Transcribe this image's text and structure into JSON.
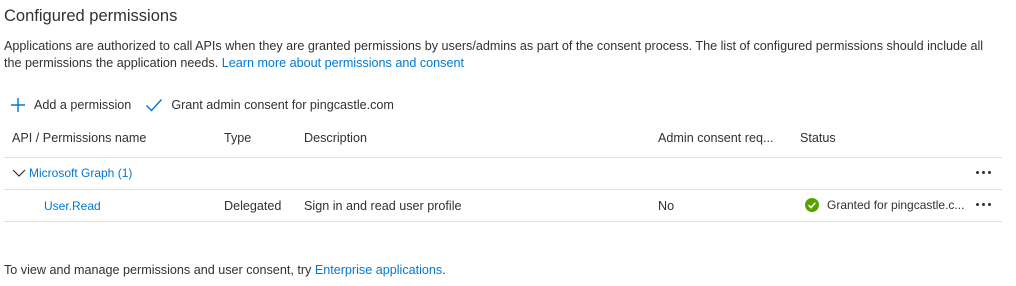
{
  "section_title": "Configured permissions",
  "description": {
    "text": "Applications are authorized to call APIs when they are granted permissions by users/admins as part of the consent process. The list of configured permissions should include all the permissions the application needs.",
    "link": "Learn more about permissions and consent"
  },
  "toolbar": {
    "add_label": "Add a permission",
    "grant_label": "Grant admin consent for pingcastle.com"
  },
  "table": {
    "headers": {
      "api": "API / Permissions name",
      "type": "Type",
      "description": "Description",
      "admin_consent": "Admin consent req...",
      "status": "Status"
    },
    "group": {
      "label": "Microsoft Graph (1)"
    },
    "rows": [
      {
        "name": "User.Read",
        "type": "Delegated",
        "description": "Sign in and read user profile",
        "admin_consent": "No",
        "status": "Granted for pingcastle.c..."
      }
    ]
  },
  "footer": {
    "text": "To view and manage permissions and user consent, try",
    "link": "Enterprise applications",
    "suffix": "."
  },
  "colors": {
    "accent": "#0078d4",
    "success": "#57a300",
    "border": "#e1dfdd",
    "text": "#323130"
  }
}
